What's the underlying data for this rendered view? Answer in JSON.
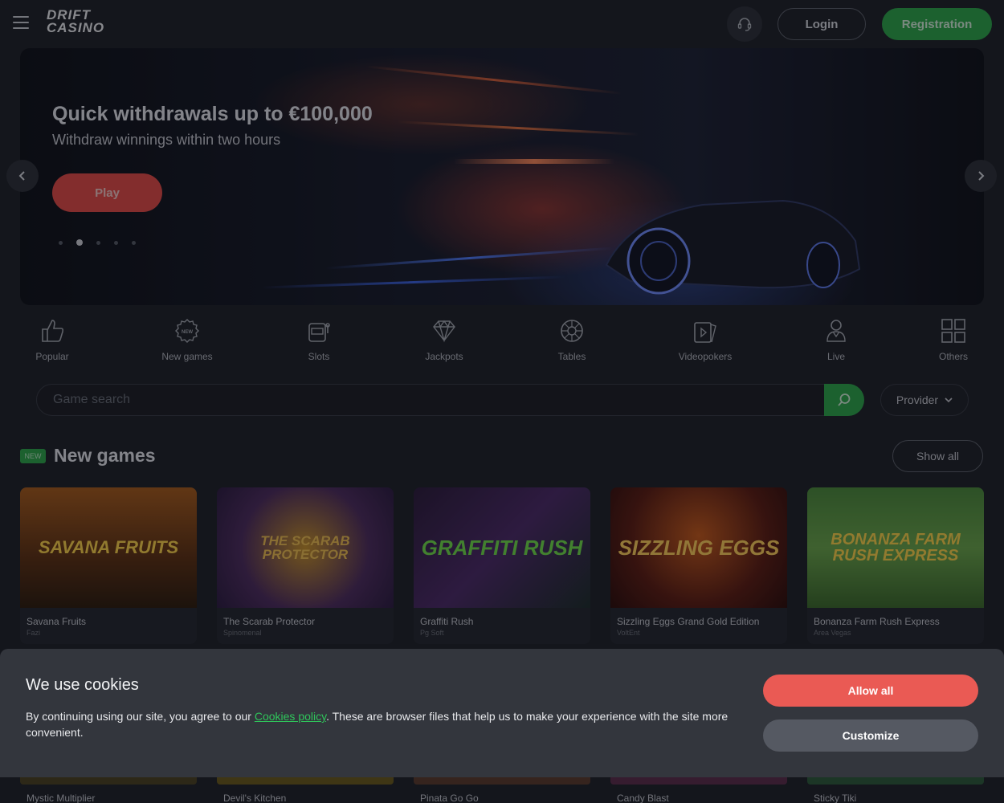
{
  "header": {
    "menu_icon": "hamburger-icon",
    "logo_line1": "DRIFT",
    "logo_line2": "CASINO",
    "support_icon": "headset-icon",
    "login_label": "Login",
    "register_label": "Registration"
  },
  "banner": {
    "title": "Quick withdrawals up to €100,000",
    "subtitle": "Withdraw winnings within two hours",
    "play_label": "Play",
    "slides_total": 5,
    "active_slide": 2
  },
  "categories": [
    {
      "label": "Popular",
      "icon": "thumbs-up-icon"
    },
    {
      "label": "New games",
      "icon": "new-badge-icon"
    },
    {
      "label": "Slots",
      "icon": "slot-machine-icon"
    },
    {
      "label": "Jackpots",
      "icon": "diamond-icon"
    },
    {
      "label": "Tables",
      "icon": "roulette-icon"
    },
    {
      "label": "Videopokers",
      "icon": "cards-icon"
    },
    {
      "label": "Live",
      "icon": "dealer-icon"
    },
    {
      "label": "Others",
      "icon": "grid-icon"
    }
  ],
  "search": {
    "placeholder": "Game search",
    "provider_label": "Provider"
  },
  "new_games": {
    "badge": "NEW",
    "title": "New games",
    "show_all_label": "Show all",
    "items": [
      {
        "name": "Savana Fruits",
        "provider": "Fazi",
        "thumb_text": "SAVANA FRUITS"
      },
      {
        "name": "The Scarab Protector",
        "provider": "Spinomenal",
        "thumb_text": "THE SCARAB PROTECTOR"
      },
      {
        "name": "Graffiti Rush",
        "provider": "Pg Soft",
        "thumb_text": "GRAFFITI RUSH"
      },
      {
        "name": "Sizzling Eggs Grand Gold Edition",
        "provider": "VoltEnt",
        "thumb_text": "SIZZLING EGGS"
      },
      {
        "name": "Bonanza Farm Rush Express",
        "provider": "Area Vegas",
        "thumb_text": "BONANZA FARM RUSH EXPRESS"
      }
    ],
    "row2": [
      {
        "name": "Mystic Multiplier"
      },
      {
        "name": "Devil's Kitchen"
      },
      {
        "name": "Pinata Go Go"
      },
      {
        "name": "Candy Blast"
      },
      {
        "name": "Sticky Tiki"
      }
    ]
  },
  "cookie": {
    "title": "We use cookies",
    "text_before": "By continuing using our site, you agree to our ",
    "link_text": "Cookies policy",
    "text_after": ". These are browser files that help us to make your experience with the site more convenient.",
    "allow_label": "Allow all",
    "customize_label": "Customize"
  },
  "colors": {
    "accent_green": "#2aa84a",
    "accent_red": "#e64a45",
    "background": "#1d2027"
  }
}
